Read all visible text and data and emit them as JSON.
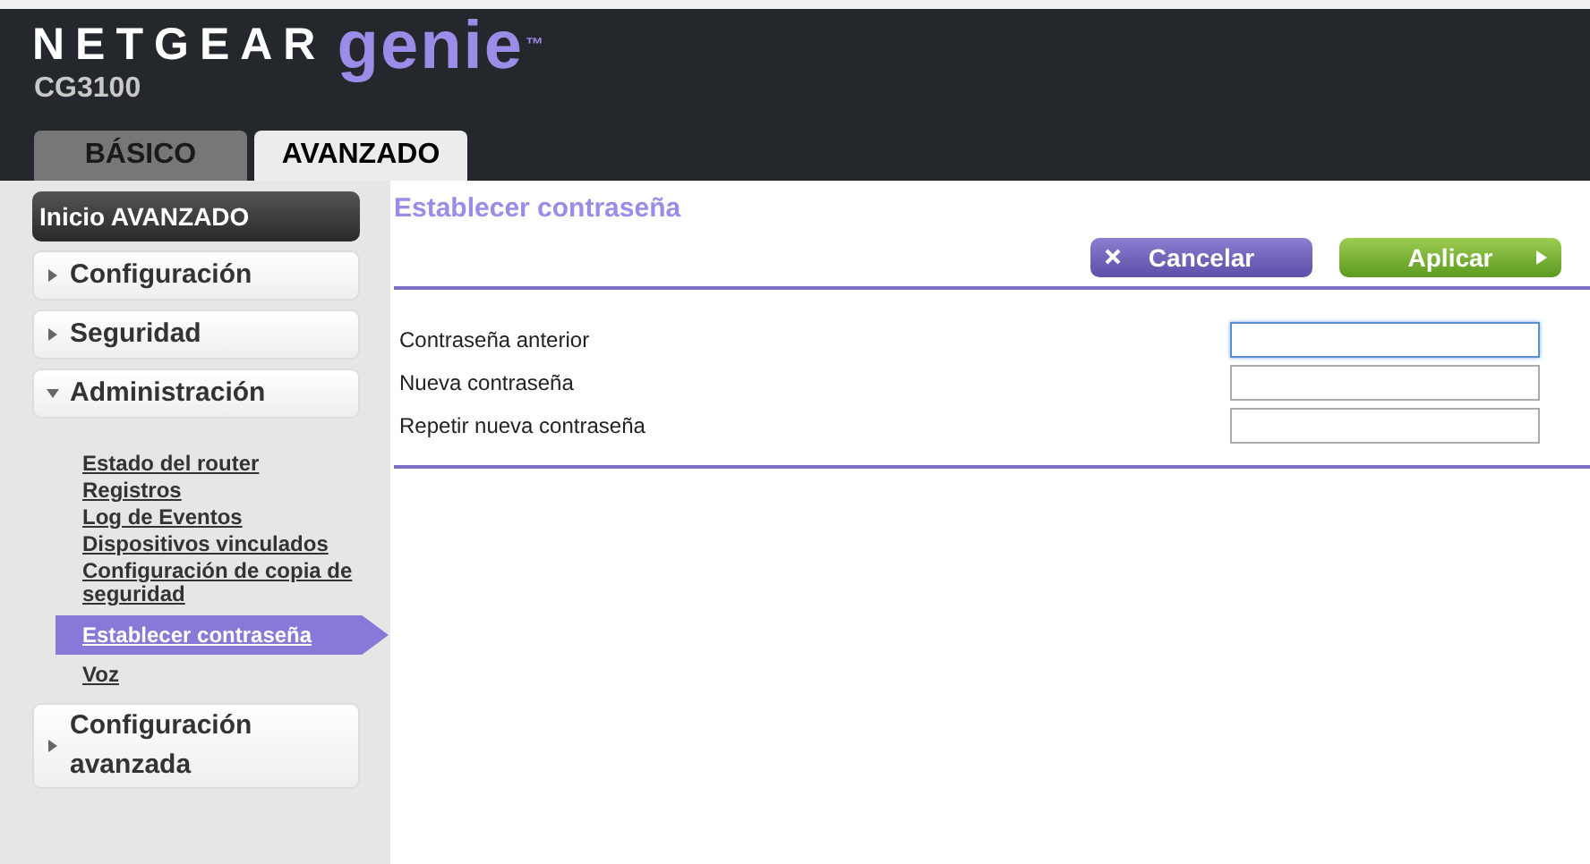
{
  "header": {
    "brand": "NETGEAR",
    "product": "genie",
    "trademark": "™",
    "model": "CG3100"
  },
  "tabs": [
    {
      "label": "BÁSICO",
      "selected": false
    },
    {
      "label": "AVANZADO",
      "selected": true
    }
  ],
  "sidebar": {
    "home": "Inicio AVANZADO",
    "items": [
      {
        "label": "Configuración",
        "expanded": false
      },
      {
        "label": "Seguridad",
        "expanded": false
      },
      {
        "label": "Administración",
        "expanded": true,
        "children": [
          {
            "label": "Estado del router",
            "selected": false
          },
          {
            "label": "Registros",
            "selected": false
          },
          {
            "label": "Log de Eventos",
            "selected": false
          },
          {
            "label": "Dispositivos vinculados",
            "selected": false
          },
          {
            "label": "Configuración de copia de seguridad",
            "selected": false
          },
          {
            "label": "Establecer contraseña",
            "selected": true
          },
          {
            "label": "Voz",
            "selected": false
          }
        ]
      },
      {
        "label": "Configuración avanzada",
        "expanded": false
      }
    ]
  },
  "page": {
    "title": "Establecer contraseña",
    "buttons": [
      {
        "kind": "cancel",
        "label": "Cancelar"
      },
      {
        "kind": "apply",
        "label": "Aplicar"
      }
    ],
    "fields": [
      {
        "label": "Contraseña anterior",
        "focused": true
      },
      {
        "label": "Nueva contraseña",
        "focused": false
      },
      {
        "label": "Repetir nueva contraseña",
        "focused": false
      }
    ]
  }
}
